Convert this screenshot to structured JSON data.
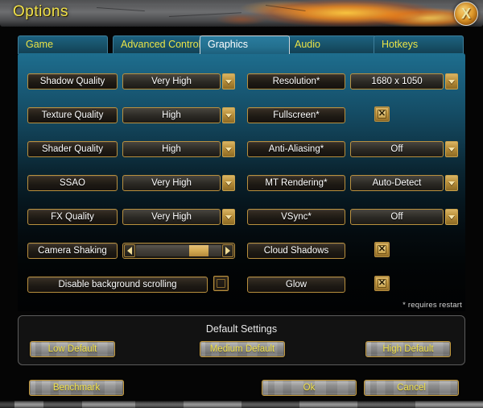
{
  "window": {
    "title": "Options",
    "close_icon": "close-x-icon"
  },
  "tabs": [
    {
      "label": "Game",
      "active": false
    },
    {
      "label": "Advanced Controls",
      "active": false
    },
    {
      "label": "Graphics",
      "active": true
    },
    {
      "label": "Audio",
      "active": false
    },
    {
      "label": "Hotkeys",
      "active": false
    }
  ],
  "settings": {
    "left_column": [
      {
        "label": "Shadow Quality",
        "control": "dropdown",
        "value": "Very High"
      },
      {
        "label": "Texture Quality",
        "control": "dropdown",
        "value": "High"
      },
      {
        "label": "Shader Quality",
        "control": "dropdown",
        "value": "High"
      },
      {
        "label": "SSAO",
        "control": "dropdown",
        "value": "Very High"
      },
      {
        "label": "FX Quality",
        "control": "dropdown",
        "value": "Very High"
      },
      {
        "label": "Camera Shaking",
        "control": "slider",
        "value": 85
      },
      {
        "label": "Disable background scrolling",
        "control": "checkbox",
        "checked": false
      }
    ],
    "right_column": [
      {
        "label": "Resolution*",
        "control": "dropdown",
        "value": "1680 x 1050"
      },
      {
        "label": "Fullscreen*",
        "control": "checkbox",
        "checked": true
      },
      {
        "label": "Anti-Aliasing*",
        "control": "dropdown",
        "value": "Off"
      },
      {
        "label": "MT Rendering*",
        "control": "dropdown",
        "value": "Auto-Detect"
      },
      {
        "label": "VSync*",
        "control": "dropdown",
        "value": "Off"
      },
      {
        "label": "Cloud Shadows",
        "control": "checkbox",
        "checked": true
      },
      {
        "label": "Glow",
        "control": "checkbox",
        "checked": true
      }
    ],
    "restart_note": "* requires restart"
  },
  "default_settings": {
    "title": "Default Settings",
    "low": "Low Default",
    "medium": "Medium Default",
    "high": "High Default"
  },
  "footer": {
    "benchmark": "Benchmark",
    "ok": "Ok",
    "cancel": "Cancel"
  },
  "colors": {
    "accent_gold": "#b9903e",
    "title_yellow": "#f1e24a",
    "tab_teal": "#1d6280",
    "panel_top": "#1e6e8e",
    "stone_button": "#969696"
  }
}
